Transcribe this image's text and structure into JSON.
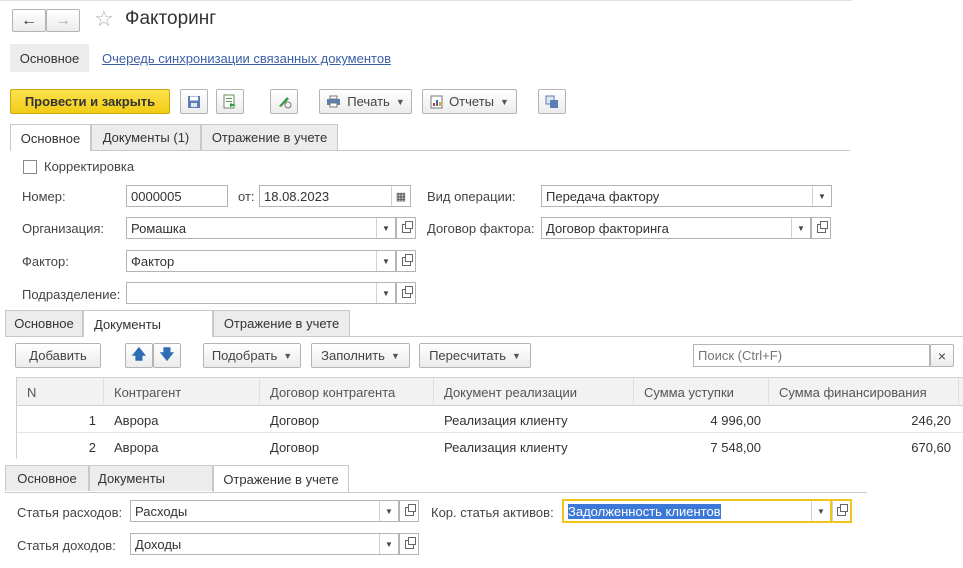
{
  "title": "Факторинг",
  "nav": {
    "main": "Основное",
    "link": "Очередь синхронизации связанных документов"
  },
  "toolbar": {
    "post_close": "Провести и закрыть",
    "print": "Печать",
    "reports": "Отчеты"
  },
  "header_tabs": [
    "Основное",
    "Документы (1)",
    "Отражение в учете"
  ],
  "form": {
    "correction_label": "Корректировка",
    "number_label": "Номер:",
    "number_value": "0000005",
    "from_label": "от:",
    "date_value": "18.08.2023",
    "op_label": "Вид операции:",
    "op_value": "Передача фактору",
    "org_label": "Организация:",
    "org_value": "Ромашка",
    "contract_label": "Договор фактора:",
    "contract_value": "Договор факторинга",
    "factor_label": "Фактор:",
    "factor_value": "Фактор",
    "dept_label": "Подразделение:",
    "dept_value": ""
  },
  "docs_tabs": [
    "Основное",
    "Документы",
    "Отражение в учете"
  ],
  "docs_toolbar": {
    "add": "Добавить",
    "pick": "Подобрать",
    "fill": "Заполнить",
    "recalc": "Пересчитать",
    "search_placeholder": "Поиск (Ctrl+F)",
    "clear": "×"
  },
  "table": {
    "columns": [
      "N",
      "Контрагент",
      "Договор контрагента",
      "Документ реализации",
      "Сумма уступки",
      "Сумма финансирования"
    ],
    "rows": [
      [
        "1",
        "Аврора",
        "Договор",
        "Реализация клиенту",
        "4 996,00",
        "246,20"
      ],
      [
        "2",
        "Аврора",
        "Договор",
        "Реализация клиенту",
        "7 548,00",
        "670,60"
      ]
    ]
  },
  "acc_tabs": [
    "Основное",
    "Документы",
    "Отражение в учете"
  ],
  "accounting": {
    "expense_label": "Статья расходов:",
    "expense_value": "Расходы",
    "asset_label": "Кор. статья активов:",
    "asset_value": "Задолженность клиентов",
    "income_label": "Статья доходов:",
    "income_value": "Доходы"
  },
  "colors": {
    "primary_button": "#f7d51d",
    "link": "#3b5fa6",
    "selection": "#3c78d8",
    "focus_border": "#f0c419"
  }
}
